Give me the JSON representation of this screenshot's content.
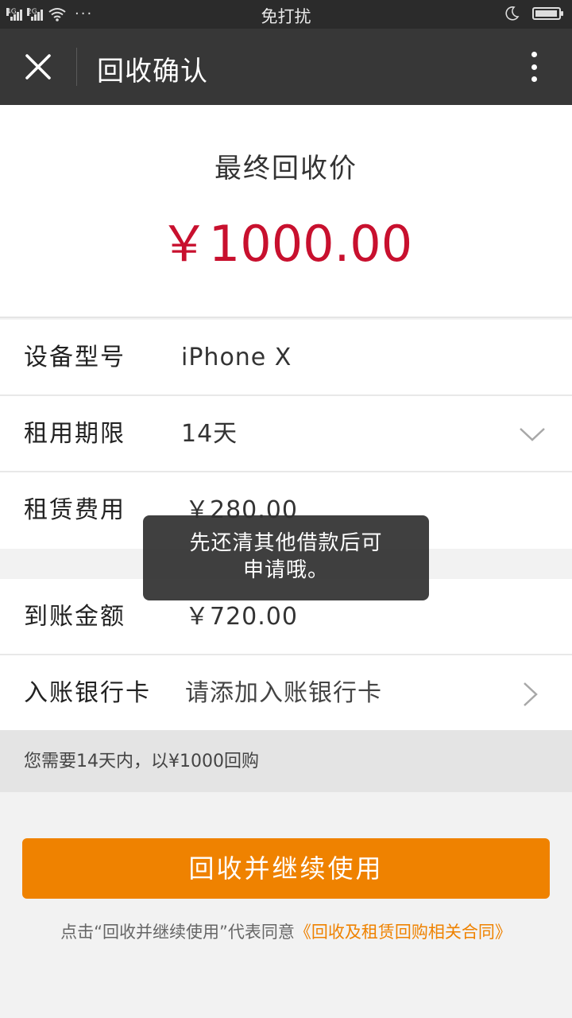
{
  "status_bar": {
    "network_1": "4G",
    "network_2": "2G",
    "center_text": "免打扰",
    "battery_level": 0.95
  },
  "header": {
    "title": "回收确认"
  },
  "price": {
    "label": "最终回收价",
    "value": "￥1000.00"
  },
  "details": {
    "model_label": "设备型号",
    "model_value": "iPhone X",
    "term_label": "租用期限",
    "term_value": "14天",
    "fee_label": "租赁费用",
    "fee_value": "￥280.00"
  },
  "payout": {
    "amount_label": "到账金额",
    "amount_value": "￥720.00",
    "card_label": "入账银行卡",
    "card_placeholder": "请添加入账银行卡"
  },
  "note": "您需要14天内，以¥1000回购",
  "primary_button": "回收并继续使用",
  "agreement": {
    "prefix": "点击“回收并继续使用”代表同意",
    "link": "《回收及租赁回购相关合同》"
  },
  "toast": {
    "line1": "先还清其他借款后可",
    "line2": "申请哦。"
  },
  "colors": {
    "price_red": "#c8102e",
    "accent_orange": "#ef8200",
    "header_bg": "#373737"
  }
}
